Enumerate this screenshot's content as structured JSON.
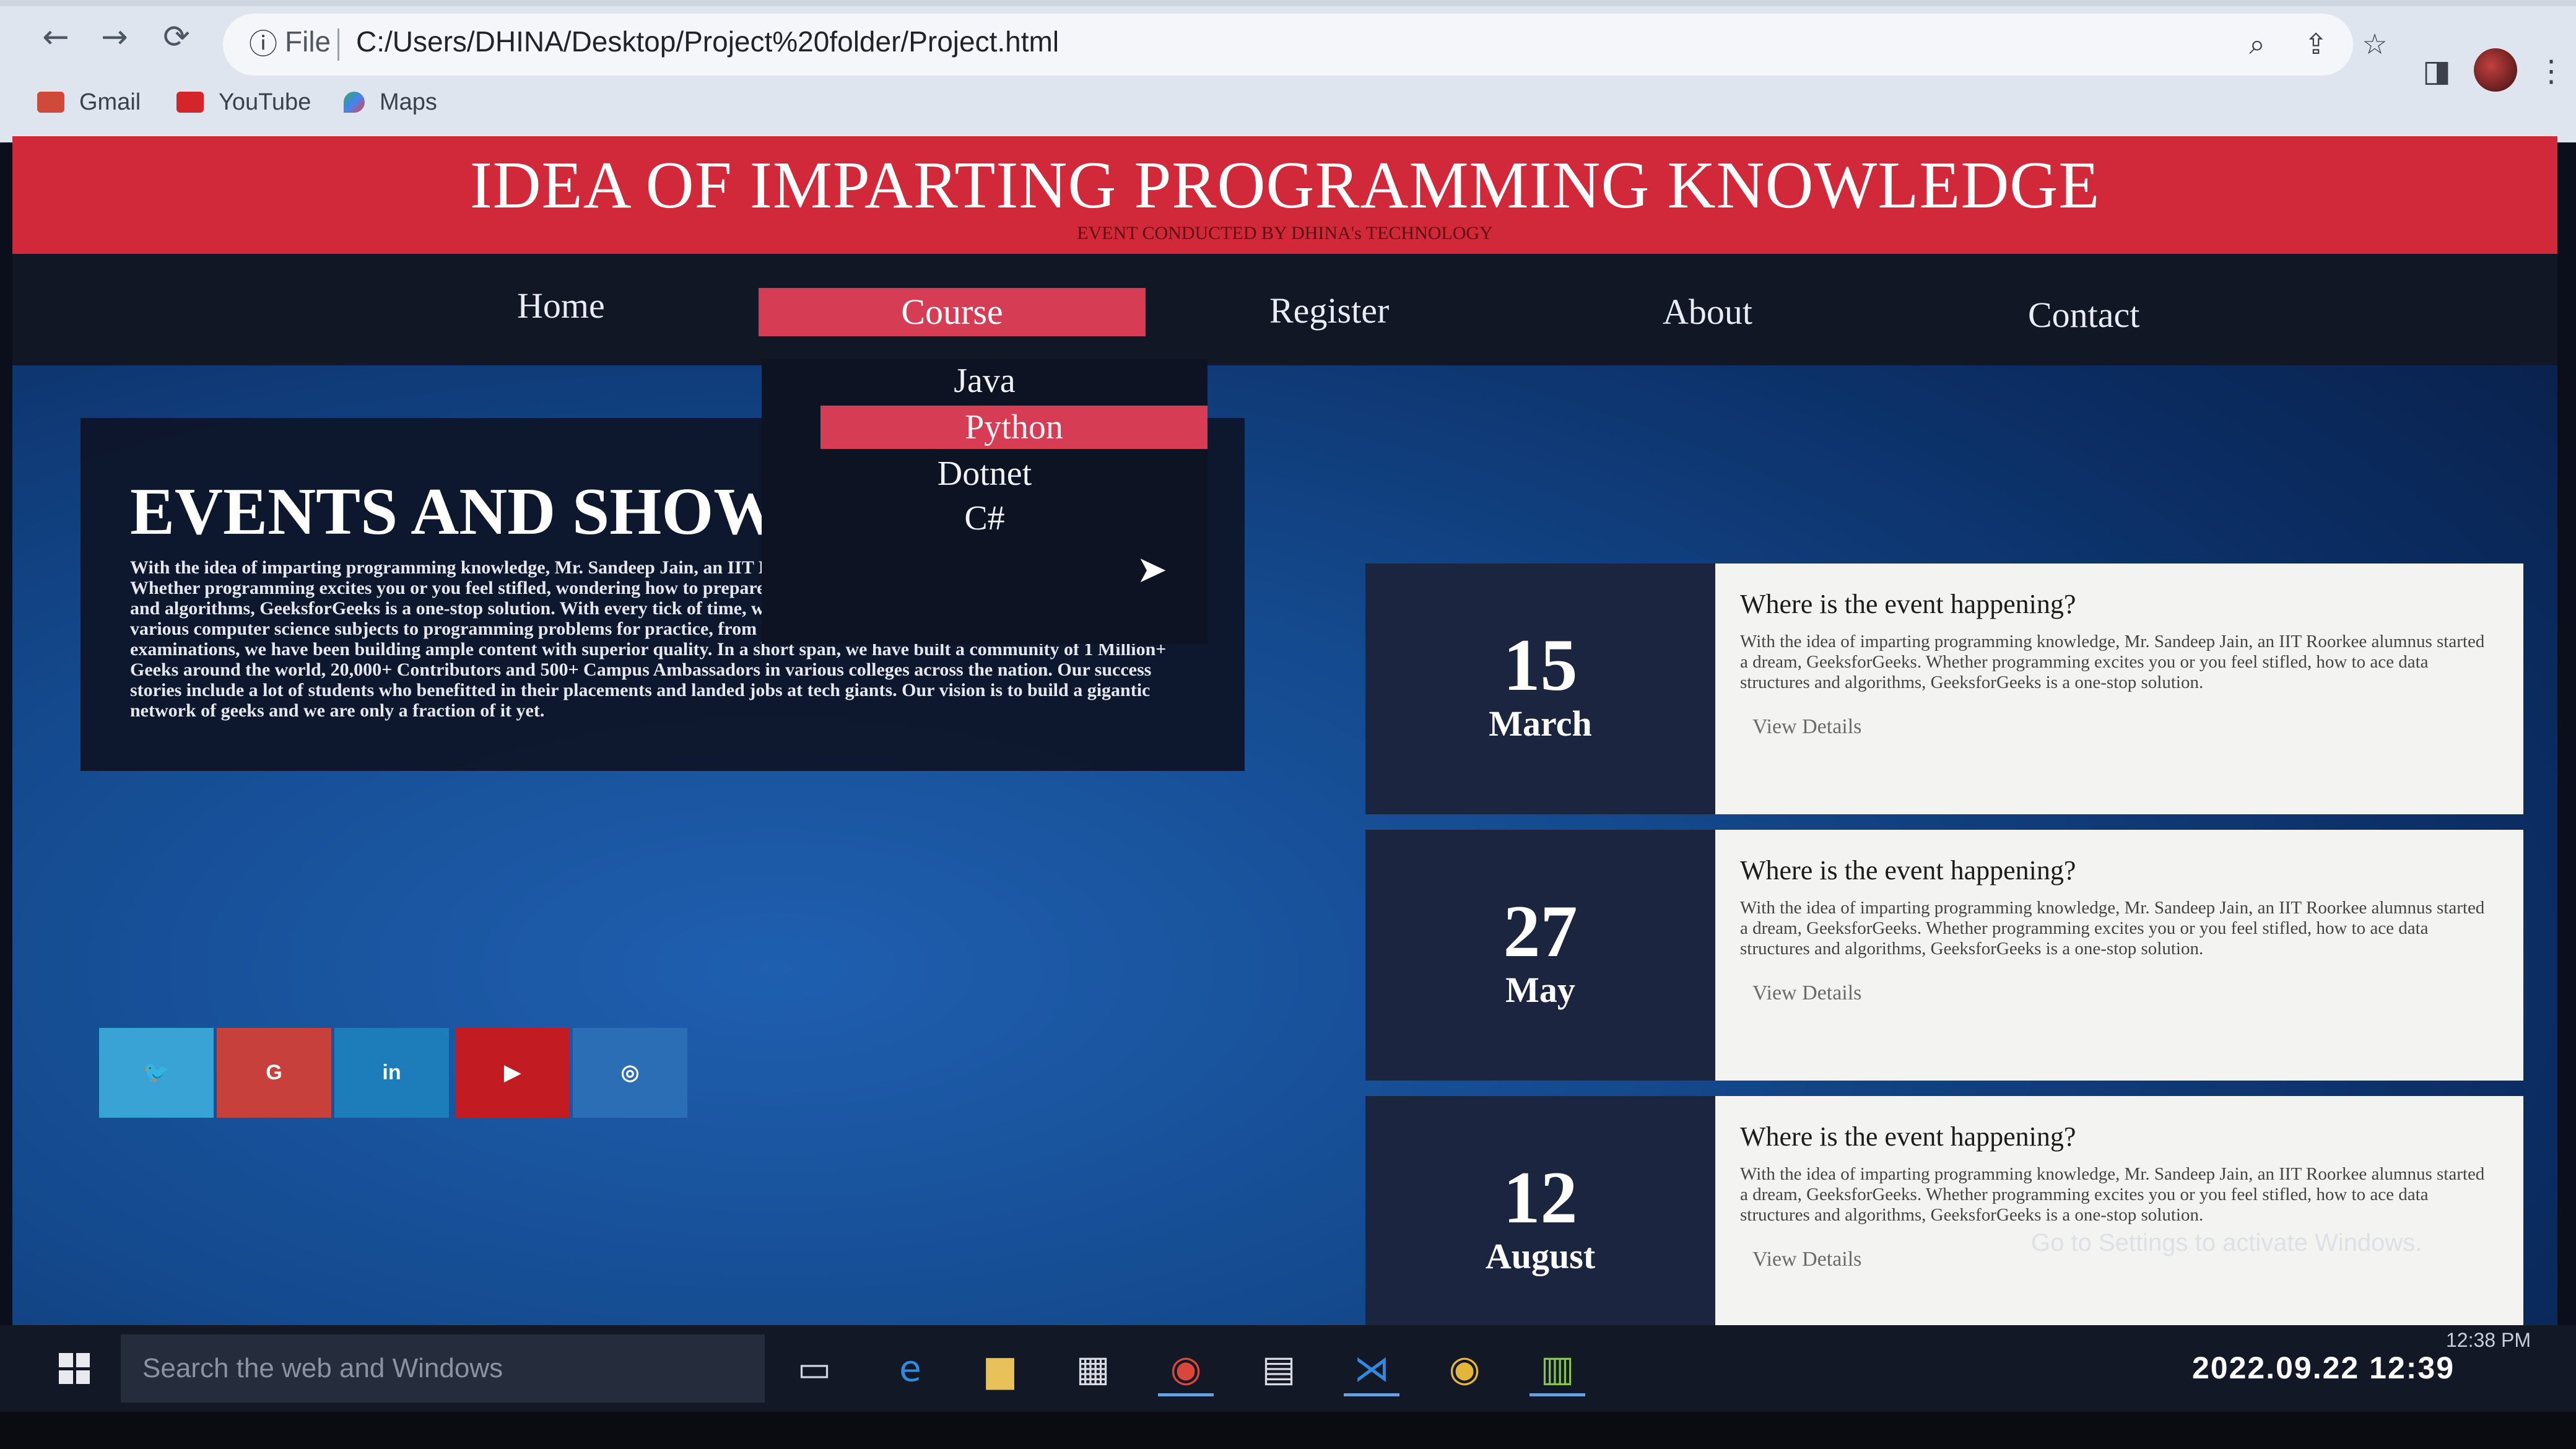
{
  "browser": {
    "back": "←",
    "forward": "→",
    "reload": "⟳",
    "file_label": "File",
    "url": "C:/Users/DHINA/Desktop/Project%20folder/Project.html",
    "bookmarks": [
      "Gmail",
      "YouTube",
      "Maps"
    ]
  },
  "site": {
    "title": "IDEA OF IMPARTING PROGRAMMING KNOWLEDGE",
    "subtitle": "EVENT CONDUCTED BY DHINA's TECHNOLOGY"
  },
  "nav": {
    "home": "Home",
    "course": "Course",
    "register": "Register",
    "about": "About",
    "contact": "Contact"
  },
  "dropdown": {
    "items": [
      "Java",
      "Python",
      "Dotnet",
      "C#"
    ],
    "active": "Python"
  },
  "events": {
    "title": "EVENTS AND SHOWS",
    "text": "With the idea of imparting programming knowledge, Mr. Sandeep Jain, an IIT Roorkee alumnus started a dream, GeeksforGeeks. Whether programming excites you or you feel stifled, wondering how to prepare for interview questions or how to ace data structures and algorithms, GeeksforGeeks is a one-stop solution. With every tick of time, we are adding arrows in our quiver. From articles on various computer science subjects to programming problems for practice, from basic to premium courses, from technologies to entrance examinations, we have been building ample content with superior quality. In a short span, we have built a community of 1 Million+ Geeks around the world, 20,000+ Contributors and 500+ Campus Ambassadors in various colleges across the nation. Our success stories include a lot of students who benefitted in their placements and landed jobs at tech giants. Our vision is to build a gigantic network of geeks and we are only a fraction of it yet."
  },
  "social": [
    {
      "icon": "twitter-icon",
      "glyph": "🐦",
      "color": "#3aa3d5"
    },
    {
      "icon": "google-icon",
      "glyph": "G",
      "color": "#c8403c"
    },
    {
      "icon": "linkedin-icon",
      "glyph": "in",
      "color": "#1d7dbb"
    },
    {
      "icon": "youtube-icon",
      "glyph": "▶",
      "color": "#c21b22"
    },
    {
      "icon": "instagram-icon",
      "glyph": "◎",
      "color": "#2c6eb6"
    }
  ],
  "event_cards": [
    {
      "day": "15",
      "month": "March",
      "title": "Where is the event happening?",
      "text": "With the idea of imparting programming knowledge, Mr. Sandeep Jain, an IIT Roorkee alumnus started a dream, GeeksforGeeks. Whether programming excites you or you feel stifled, how to ace data structures and algorithms, GeeksforGeeks is a one-stop solution.",
      "link": "View Details"
    },
    {
      "day": "27",
      "month": "May",
      "title": "Where is the event happening?",
      "text": "With the idea of imparting programming knowledge, Mr. Sandeep Jain, an IIT Roorkee alumnus started a dream, GeeksforGeeks. Whether programming excites you or you feel stifled, how to ace data structures and algorithms, GeeksforGeeks is a one-stop solution.",
      "link": "View Details"
    },
    {
      "day": "12",
      "month": "August",
      "title": "Where is the event happening?",
      "text": "With the idea of imparting programming knowledge, Mr. Sandeep Jain, an IIT Roorkee alumnus started a dream, GeeksforGeeks. Whether programming excites you or you feel stifled, how to ace data structures and algorithms, GeeksforGeeks is a one-stop solution.",
      "link": "View Details"
    }
  ],
  "watermark": "Go to Settings to activate Windows.",
  "taskbar": {
    "search_placeholder": "Search the web and Windows",
    "tray_time": "12:38 PM",
    "photo_stamp": "2022.09.22 12:39"
  }
}
